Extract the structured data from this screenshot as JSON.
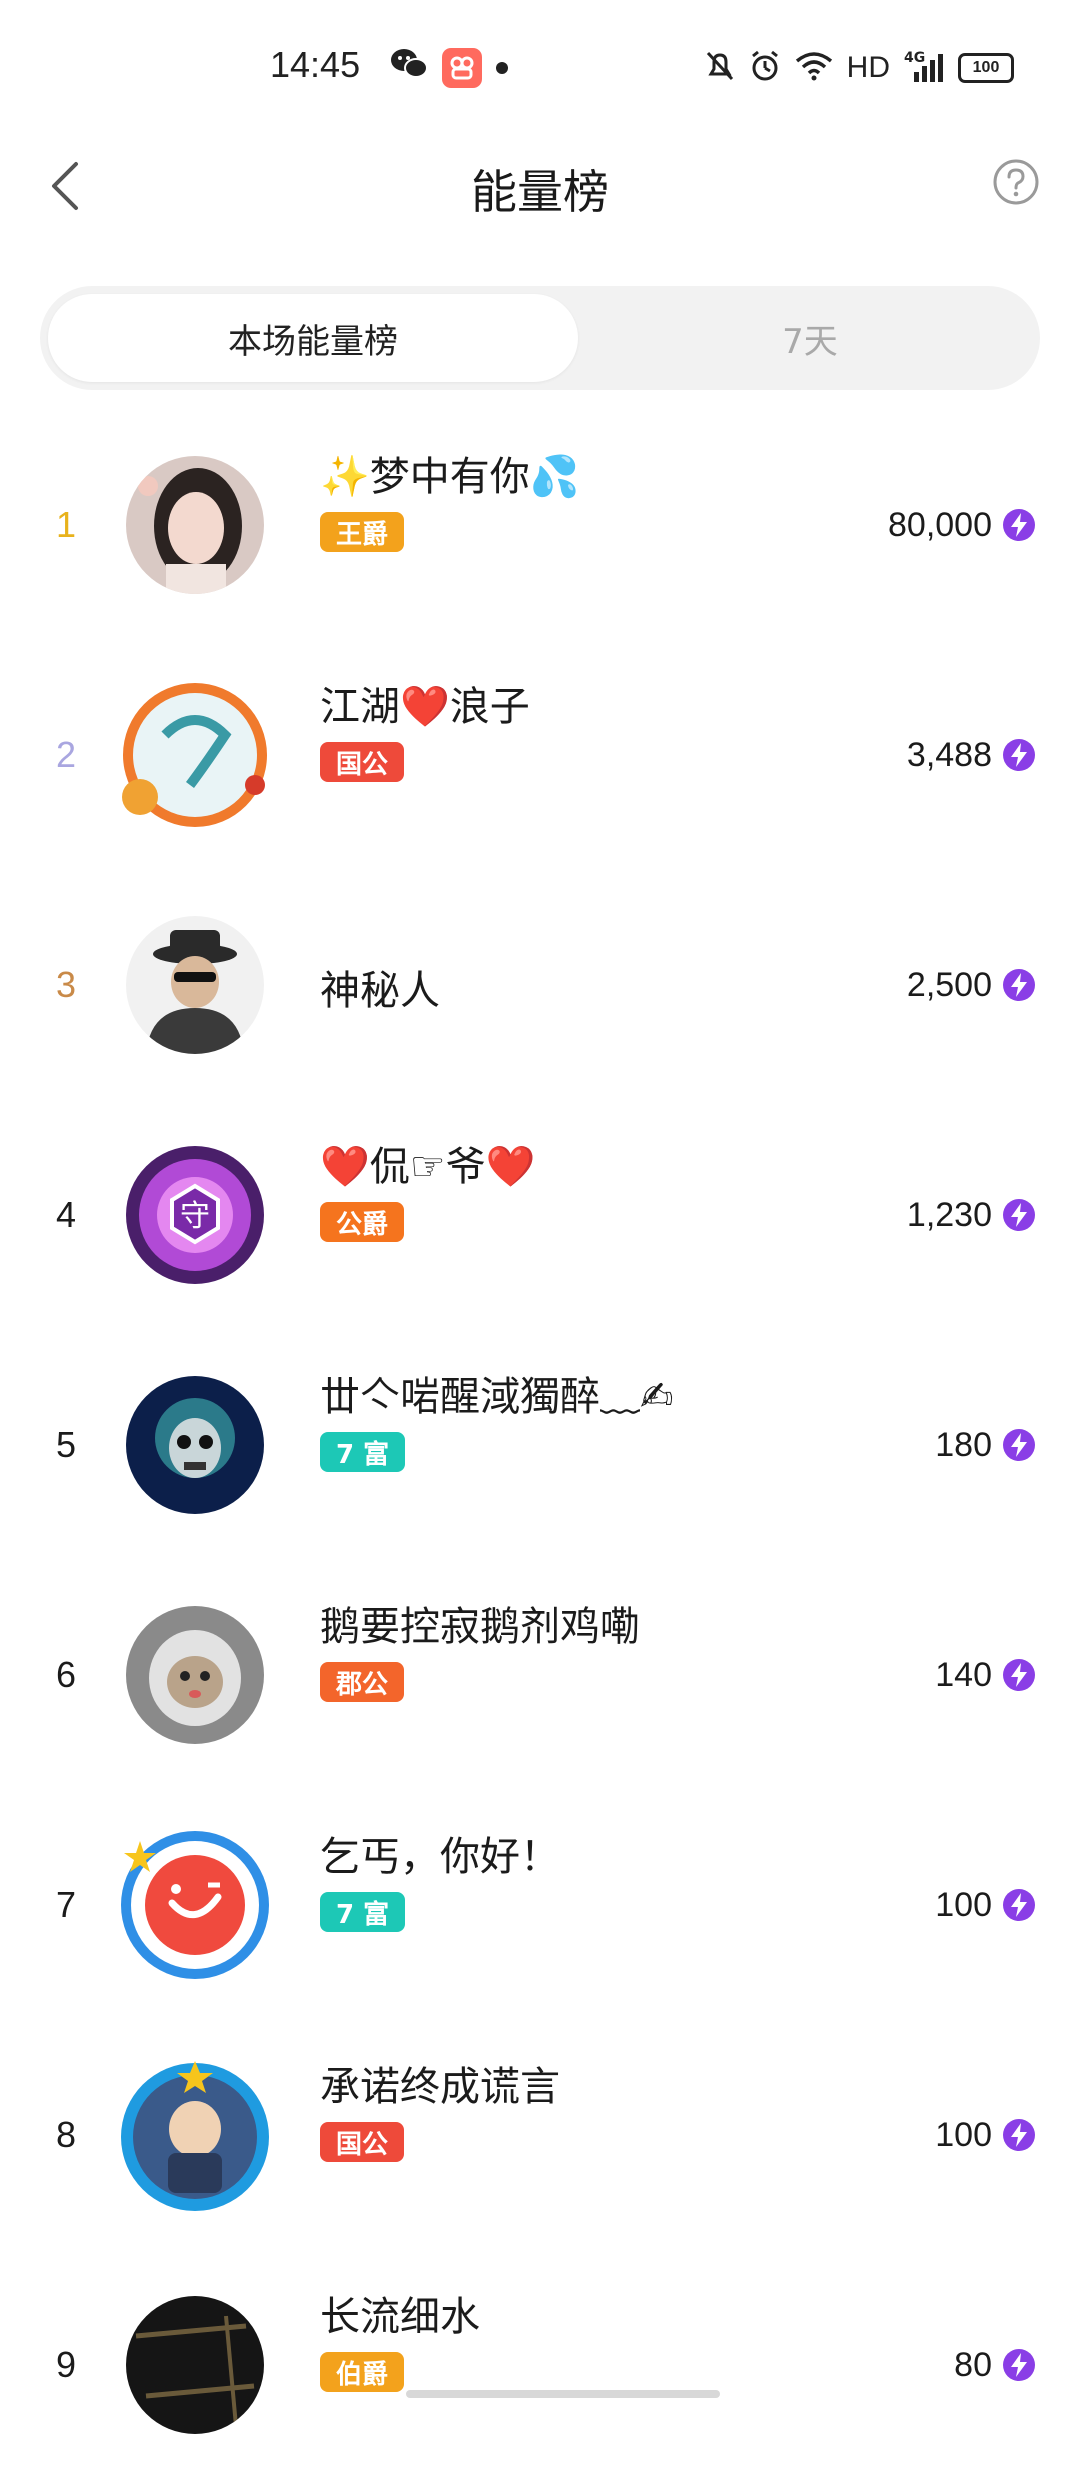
{
  "status_bar": {
    "time": "14:45",
    "network": "HD",
    "signal": "4G",
    "battery": "100"
  },
  "header": {
    "title": "能量榜"
  },
  "tabs": [
    {
      "label": "本场能量榜",
      "active": true
    },
    {
      "label": "7天",
      "active": false
    }
  ],
  "colors": {
    "rank1": "#e8b21c",
    "rank2": "#a9a6e0",
    "rank3": "#c98a48",
    "bolt": "#8a3ee6"
  },
  "ranking": [
    {
      "rank": "1",
      "name": "✨梦中有你💦",
      "badge": "王爵",
      "badge_color": "#f3a21c",
      "value": "80,000"
    },
    {
      "rank": "2",
      "name": "江湖❤️浪子",
      "badge": "国公",
      "badge_color": "#ee4a3a",
      "value": "3,488"
    },
    {
      "rank": "3",
      "name": "神秘人",
      "badge": "",
      "badge_color": "",
      "value": "2,500"
    },
    {
      "rank": "4",
      "name": "❤️侃☞爷❤️",
      "badge": "公爵",
      "badge_color": "#f5741e",
      "value": "1,230"
    },
    {
      "rank": "5",
      "name": "丗亽啱醒淢獨醉﹏✍",
      "badge": "7 富",
      "badge_color": "#1dc8b6",
      "value": "180"
    },
    {
      "rank": "6",
      "name": "鹅要控寂鹅剂鸡嘞",
      "badge": "郡公",
      "badge_color": "#f3652b",
      "value": "140"
    },
    {
      "rank": "7",
      "name": "乞丐，你好！",
      "badge": "7 富",
      "badge_color": "#1dc8b6",
      "value": "100"
    },
    {
      "rank": "8",
      "name": "承诺终成谎言",
      "badge": "国公",
      "badge_color": "#ee4a3a",
      "value": "100"
    },
    {
      "rank": "9",
      "name": "长流细水",
      "badge": "伯爵",
      "badge_color": "#f3a21c",
      "value": "80"
    }
  ]
}
